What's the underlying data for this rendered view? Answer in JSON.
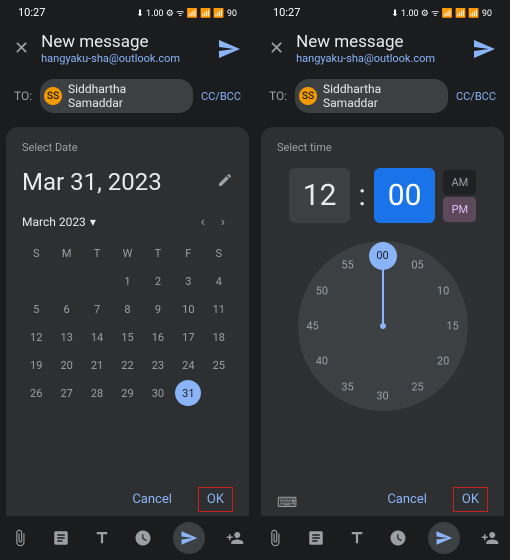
{
  "status": {
    "time": "10:27",
    "icons": "⬇ 1.00 ⚙ ᯤ 📶 📶 📶 90"
  },
  "header": {
    "title": "New message",
    "email": "hangyaku-sha@outlook.com"
  },
  "to": {
    "label": "TO:",
    "recipient": "Siddhartha Samaddar",
    "initials": "SS",
    "cc": "CC/BCC"
  },
  "date_dialog": {
    "title": "Select Date",
    "selected": "Mar 31, 2023",
    "month": "March 2023",
    "dow": [
      "S",
      "M",
      "T",
      "W",
      "T",
      "F",
      "S"
    ],
    "weeks": [
      [
        "",
        "",
        "",
        "1",
        "2",
        "3",
        "4"
      ],
      [
        "5",
        "6",
        "7",
        "8",
        "9",
        "10",
        "11"
      ],
      [
        "12",
        "13",
        "14",
        "15",
        "16",
        "17",
        "18"
      ],
      [
        "19",
        "20",
        "21",
        "22",
        "23",
        "24",
        "25"
      ],
      [
        "26",
        "27",
        "28",
        "29",
        "30",
        "31",
        ""
      ]
    ],
    "selected_day": "31",
    "cancel": "Cancel",
    "ok": "OK"
  },
  "time_dialog": {
    "title": "Select time",
    "hour": "12",
    "minute": "00",
    "am": "AM",
    "pm": "PM",
    "active_ampm": "PM",
    "ticks": [
      "00",
      "05",
      "10",
      "15",
      "20",
      "25",
      "30",
      "35",
      "40",
      "45",
      "50",
      "55"
    ],
    "selected_tick": "00",
    "cancel": "Cancel",
    "ok": "OK"
  }
}
